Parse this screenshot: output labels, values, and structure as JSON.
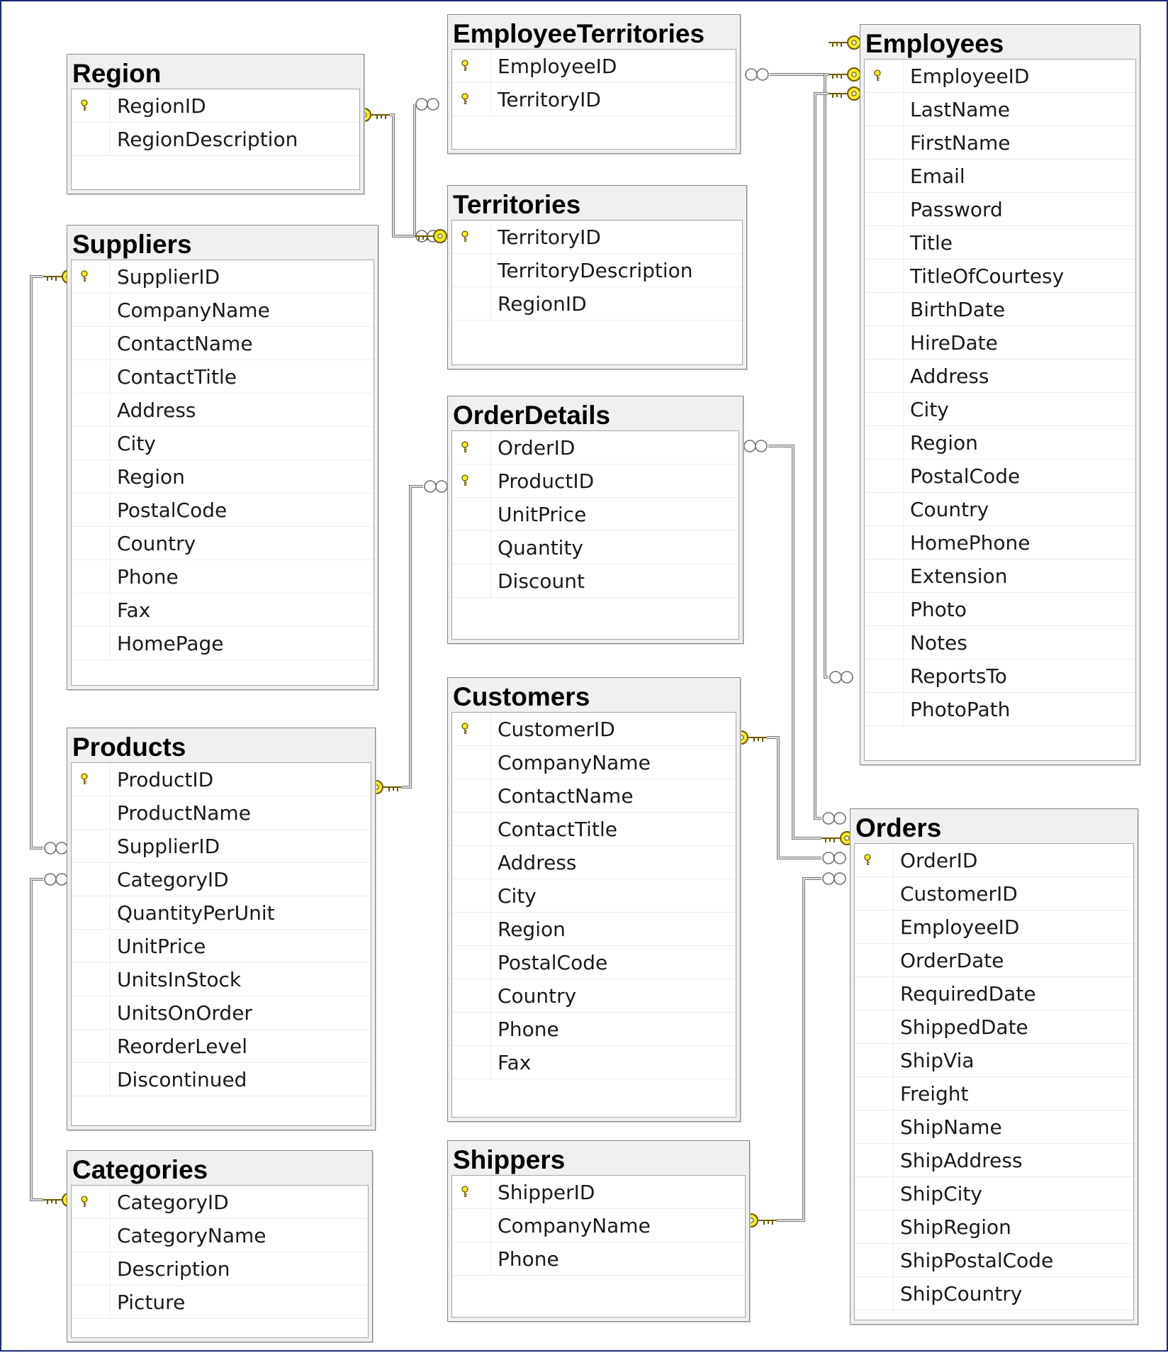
{
  "diagram": {
    "colors": {
      "frame": "#1c2a7a",
      "table_header": "#f0f0f0",
      "key_fill": "#f4ec26",
      "key_stroke": "#6b5a00",
      "relationship_line": "#7d7d7d"
    },
    "tables": [
      {
        "id": "region",
        "title": "Region",
        "columns": [
          {
            "name": "RegionID",
            "pk": true
          },
          {
            "name": "RegionDescription",
            "pk": false
          }
        ]
      },
      {
        "id": "employeeterritories",
        "title": "EmployeeTerritories",
        "columns": [
          {
            "name": "EmployeeID",
            "pk": true
          },
          {
            "name": "TerritoryID",
            "pk": true
          }
        ]
      },
      {
        "id": "territories",
        "title": "Territories",
        "columns": [
          {
            "name": "TerritoryID",
            "pk": true
          },
          {
            "name": "TerritoryDescription",
            "pk": false
          },
          {
            "name": "RegionID",
            "pk": false
          }
        ]
      },
      {
        "id": "employees",
        "title": "Employees",
        "columns": [
          {
            "name": "EmployeeID",
            "pk": true
          },
          {
            "name": "LastName",
            "pk": false
          },
          {
            "name": "FirstName",
            "pk": false
          },
          {
            "name": "Email",
            "pk": false
          },
          {
            "name": "Password",
            "pk": false
          },
          {
            "name": "Title",
            "pk": false
          },
          {
            "name": "TitleOfCourtesy",
            "pk": false
          },
          {
            "name": "BirthDate",
            "pk": false
          },
          {
            "name": "HireDate",
            "pk": false
          },
          {
            "name": "Address",
            "pk": false
          },
          {
            "name": "City",
            "pk": false
          },
          {
            "name": "Region",
            "pk": false
          },
          {
            "name": "PostalCode",
            "pk": false
          },
          {
            "name": "Country",
            "pk": false
          },
          {
            "name": "HomePhone",
            "pk": false
          },
          {
            "name": "Extension",
            "pk": false
          },
          {
            "name": "Photo",
            "pk": false
          },
          {
            "name": "Notes",
            "pk": false
          },
          {
            "name": "ReportsTo",
            "pk": false
          },
          {
            "name": "PhotoPath",
            "pk": false
          }
        ]
      },
      {
        "id": "suppliers",
        "title": "Suppliers",
        "columns": [
          {
            "name": "SupplierID",
            "pk": true
          },
          {
            "name": "CompanyName",
            "pk": false
          },
          {
            "name": "ContactName",
            "pk": false
          },
          {
            "name": "ContactTitle",
            "pk": false
          },
          {
            "name": "Address",
            "pk": false
          },
          {
            "name": "City",
            "pk": false
          },
          {
            "name": "Region",
            "pk": false
          },
          {
            "name": "PostalCode",
            "pk": false
          },
          {
            "name": "Country",
            "pk": false
          },
          {
            "name": "Phone",
            "pk": false
          },
          {
            "name": "Fax",
            "pk": false
          },
          {
            "name": "HomePage",
            "pk": false
          }
        ]
      },
      {
        "id": "orderdetails",
        "title": "OrderDetails",
        "columns": [
          {
            "name": "OrderID",
            "pk": true
          },
          {
            "name": "ProductID",
            "pk": true
          },
          {
            "name": "UnitPrice",
            "pk": false
          },
          {
            "name": "Quantity",
            "pk": false
          },
          {
            "name": "Discount",
            "pk": false
          }
        ]
      },
      {
        "id": "customers",
        "title": "Customers",
        "columns": [
          {
            "name": "CustomerID",
            "pk": true
          },
          {
            "name": "CompanyName",
            "pk": false
          },
          {
            "name": "ContactName",
            "pk": false
          },
          {
            "name": "ContactTitle",
            "pk": false
          },
          {
            "name": "Address",
            "pk": false
          },
          {
            "name": "City",
            "pk": false
          },
          {
            "name": "Region",
            "pk": false
          },
          {
            "name": "PostalCode",
            "pk": false
          },
          {
            "name": "Country",
            "pk": false
          },
          {
            "name": "Phone",
            "pk": false
          },
          {
            "name": "Fax",
            "pk": false
          }
        ]
      },
      {
        "id": "products",
        "title": "Products",
        "columns": [
          {
            "name": "ProductID",
            "pk": true
          },
          {
            "name": "ProductName",
            "pk": false
          },
          {
            "name": "SupplierID",
            "pk": false
          },
          {
            "name": "CategoryID",
            "pk": false
          },
          {
            "name": "QuantityPerUnit",
            "pk": false
          },
          {
            "name": "UnitPrice",
            "pk": false
          },
          {
            "name": "UnitsInStock",
            "pk": false
          },
          {
            "name": "UnitsOnOrder",
            "pk": false
          },
          {
            "name": "ReorderLevel",
            "pk": false
          },
          {
            "name": "Discontinued",
            "pk": false
          }
        ]
      },
      {
        "id": "orders",
        "title": "Orders",
        "columns": [
          {
            "name": "OrderID",
            "pk": true
          },
          {
            "name": "CustomerID",
            "pk": false
          },
          {
            "name": "EmployeeID",
            "pk": false
          },
          {
            "name": "OrderDate",
            "pk": false
          },
          {
            "name": "RequiredDate",
            "pk": false
          },
          {
            "name": "ShippedDate",
            "pk": false
          },
          {
            "name": "ShipVia",
            "pk": false
          },
          {
            "name": "Freight",
            "pk": false
          },
          {
            "name": "ShipName",
            "pk": false
          },
          {
            "name": "ShipAddress",
            "pk": false
          },
          {
            "name": "ShipCity",
            "pk": false
          },
          {
            "name": "ShipRegion",
            "pk": false
          },
          {
            "name": "ShipPostalCode",
            "pk": false
          },
          {
            "name": "ShipCountry",
            "pk": false
          }
        ]
      },
      {
        "id": "categories",
        "title": "Categories",
        "columns": [
          {
            "name": "CategoryID",
            "pk": true
          },
          {
            "name": "CategoryName",
            "pk": false
          },
          {
            "name": "Description",
            "pk": false
          },
          {
            "name": "Picture",
            "pk": false
          }
        ]
      },
      {
        "id": "shippers",
        "title": "Shippers",
        "columns": [
          {
            "name": "ShipperID",
            "pk": true
          },
          {
            "name": "CompanyName",
            "pk": false
          },
          {
            "name": "Phone",
            "pk": false
          }
        ]
      }
    ],
    "relationships": [
      {
        "id": "region-territories",
        "one": "region",
        "many": "territories"
      },
      {
        "id": "territories-employeeterritories",
        "one": "territories",
        "many": "employeeterritories"
      },
      {
        "id": "employees-employeeterritories",
        "one": "employees",
        "many": "employeeterritories"
      },
      {
        "id": "employees-reportsto",
        "one": "employees",
        "many": "employees"
      },
      {
        "id": "employees-orders",
        "one": "employees",
        "many": "orders"
      },
      {
        "id": "suppliers-products",
        "one": "suppliers",
        "many": "products"
      },
      {
        "id": "categories-products",
        "one": "categories",
        "many": "products"
      },
      {
        "id": "products-orderdetails",
        "one": "products",
        "many": "orderdetails"
      },
      {
        "id": "orders-orderdetails",
        "one": "orders",
        "many": "orderdetails"
      },
      {
        "id": "customers-orders",
        "one": "customers",
        "many": "orders"
      },
      {
        "id": "shippers-orders",
        "one": "shippers",
        "many": "orders"
      }
    ]
  }
}
